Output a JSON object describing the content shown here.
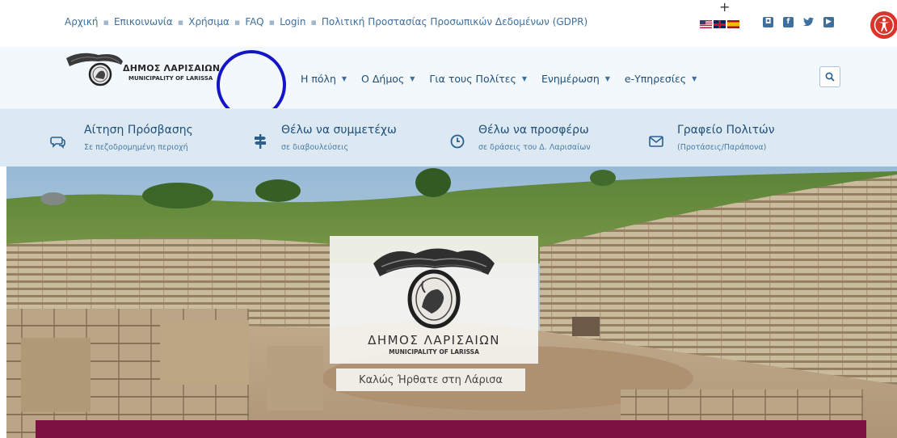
{
  "topbar": {
    "links": [
      "Αρχική",
      "Επικοινωνία",
      "Χρήσιμα",
      "FAQ",
      "Login",
      "Πολιτική Προστασίας Προσωπικών Δεδομένων (GDPR)"
    ],
    "separator": "▪",
    "flags": [
      "us-flag",
      "uk-flag",
      "es-flag"
    ],
    "social": [
      {
        "icon": "instagram-icon",
        "glyph": "◘"
      },
      {
        "icon": "facebook-icon",
        "glyph": "f"
      },
      {
        "icon": "twitter-icon",
        "glyph": "🐦"
      },
      {
        "icon": "youtube-icon",
        "glyph": "▶"
      }
    ],
    "accessibility_color": "#d9352b"
  },
  "header": {
    "logo_line1": "ΔΗΜΟΣ ΛΑΡΙΣΑΙΩΝ",
    "logo_line2": "MUNICIPALITY OF LARISSA",
    "nav": [
      "Η πόλη",
      "Ο Δήμος",
      "Για τους Πολίτες",
      "Ενημέρωση",
      "e-Υπηρεσίες"
    ],
    "nav_chevron": "⌄"
  },
  "quick_links": [
    {
      "title": "Αίτηση Πρόσβασης",
      "subtitle": "Σε πεζοδρομημένη περιοχή",
      "icon": "chat-icon"
    },
    {
      "title": "Θέλω να συμμετέχω",
      "subtitle": "σε διαβουλεύσεις",
      "icon": "signpost-icon"
    },
    {
      "title": "Θέλω να προσφέρω",
      "subtitle": "σε δράσεις του Δ. Λαρισαίων",
      "icon": "clock-icon"
    },
    {
      "title": "Γραφείο Πολιτών",
      "subtitle": "(Προτάσεις/Παράπονα)",
      "icon": "envelope-icon"
    }
  ],
  "hero": {
    "card_line1": "ΔΗΜΟΣ ΛΑΡΙΣΑΙΩΝ",
    "card_line2": "MUNICIPALITY OF LARISSA",
    "welcome": "Καλώς Ήρθατε στη Λάρισα",
    "banner_color": "#7d1141"
  },
  "colors": {
    "link": "#3f6f9c",
    "nav": "#1f4f7a",
    "quick_bg": "#dce9f3",
    "cursor_ring": "#1515c8"
  }
}
